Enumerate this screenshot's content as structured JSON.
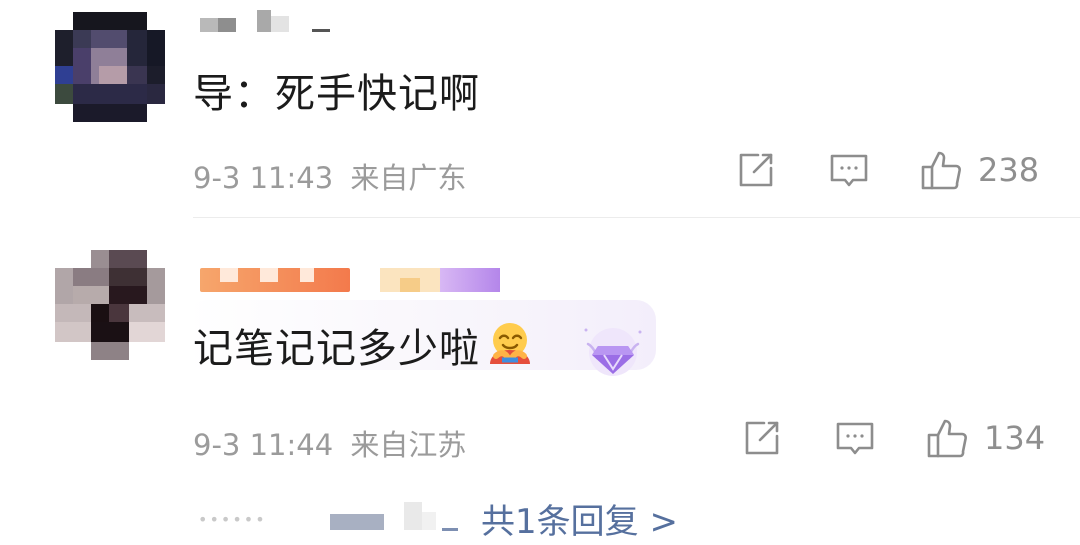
{
  "comments": [
    {
      "text": "导：死手快记啊",
      "time": "9-3 11:43",
      "location": "来自广东",
      "likes": "238",
      "avatar_icon": "pixelated-avatar",
      "username_obscured": true
    },
    {
      "text": "记笔记记多少啦",
      "emoji_icon": "hugging-face-emoji",
      "badge_icon": "purple-diamond-badge-icon",
      "time": "9-3 11:44",
      "location": "来自江苏",
      "likes": "134",
      "avatar_icon": "pixelated-avatar",
      "username_obscured": true
    }
  ],
  "replies": {
    "link_text": "共1条回复 >",
    "names_obscured": true
  },
  "colors": {
    "text": "#1b1b1b",
    "meta": "#9b9b9b",
    "link": "#56709e",
    "divider": "#ececec"
  }
}
